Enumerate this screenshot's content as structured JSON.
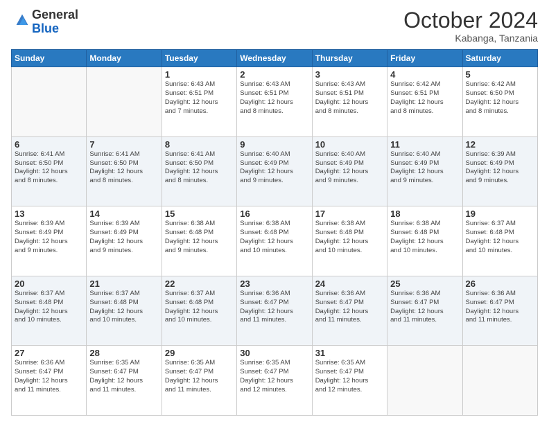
{
  "header": {
    "logo_general": "General",
    "logo_blue": "Blue",
    "month": "October 2024",
    "location": "Kabanga, Tanzania"
  },
  "weekdays": [
    "Sunday",
    "Monday",
    "Tuesday",
    "Wednesday",
    "Thursday",
    "Friday",
    "Saturday"
  ],
  "weeks": [
    [
      {
        "day": "",
        "info": ""
      },
      {
        "day": "",
        "info": ""
      },
      {
        "day": "1",
        "info": "Sunrise: 6:43 AM\nSunset: 6:51 PM\nDaylight: 12 hours\nand 7 minutes."
      },
      {
        "day": "2",
        "info": "Sunrise: 6:43 AM\nSunset: 6:51 PM\nDaylight: 12 hours\nand 8 minutes."
      },
      {
        "day": "3",
        "info": "Sunrise: 6:43 AM\nSunset: 6:51 PM\nDaylight: 12 hours\nand 8 minutes."
      },
      {
        "day": "4",
        "info": "Sunrise: 6:42 AM\nSunset: 6:51 PM\nDaylight: 12 hours\nand 8 minutes."
      },
      {
        "day": "5",
        "info": "Sunrise: 6:42 AM\nSunset: 6:50 PM\nDaylight: 12 hours\nand 8 minutes."
      }
    ],
    [
      {
        "day": "6",
        "info": "Sunrise: 6:41 AM\nSunset: 6:50 PM\nDaylight: 12 hours\nand 8 minutes."
      },
      {
        "day": "7",
        "info": "Sunrise: 6:41 AM\nSunset: 6:50 PM\nDaylight: 12 hours\nand 8 minutes."
      },
      {
        "day": "8",
        "info": "Sunrise: 6:41 AM\nSunset: 6:50 PM\nDaylight: 12 hours\nand 8 minutes."
      },
      {
        "day": "9",
        "info": "Sunrise: 6:40 AM\nSunset: 6:49 PM\nDaylight: 12 hours\nand 9 minutes."
      },
      {
        "day": "10",
        "info": "Sunrise: 6:40 AM\nSunset: 6:49 PM\nDaylight: 12 hours\nand 9 minutes."
      },
      {
        "day": "11",
        "info": "Sunrise: 6:40 AM\nSunset: 6:49 PM\nDaylight: 12 hours\nand 9 minutes."
      },
      {
        "day": "12",
        "info": "Sunrise: 6:39 AM\nSunset: 6:49 PM\nDaylight: 12 hours\nand 9 minutes."
      }
    ],
    [
      {
        "day": "13",
        "info": "Sunrise: 6:39 AM\nSunset: 6:49 PM\nDaylight: 12 hours\nand 9 minutes."
      },
      {
        "day": "14",
        "info": "Sunrise: 6:39 AM\nSunset: 6:49 PM\nDaylight: 12 hours\nand 9 minutes."
      },
      {
        "day": "15",
        "info": "Sunrise: 6:38 AM\nSunset: 6:48 PM\nDaylight: 12 hours\nand 9 minutes."
      },
      {
        "day": "16",
        "info": "Sunrise: 6:38 AM\nSunset: 6:48 PM\nDaylight: 12 hours\nand 10 minutes."
      },
      {
        "day": "17",
        "info": "Sunrise: 6:38 AM\nSunset: 6:48 PM\nDaylight: 12 hours\nand 10 minutes."
      },
      {
        "day": "18",
        "info": "Sunrise: 6:38 AM\nSunset: 6:48 PM\nDaylight: 12 hours\nand 10 minutes."
      },
      {
        "day": "19",
        "info": "Sunrise: 6:37 AM\nSunset: 6:48 PM\nDaylight: 12 hours\nand 10 minutes."
      }
    ],
    [
      {
        "day": "20",
        "info": "Sunrise: 6:37 AM\nSunset: 6:48 PM\nDaylight: 12 hours\nand 10 minutes."
      },
      {
        "day": "21",
        "info": "Sunrise: 6:37 AM\nSunset: 6:48 PM\nDaylight: 12 hours\nand 10 minutes."
      },
      {
        "day": "22",
        "info": "Sunrise: 6:37 AM\nSunset: 6:48 PM\nDaylight: 12 hours\nand 10 minutes."
      },
      {
        "day": "23",
        "info": "Sunrise: 6:36 AM\nSunset: 6:47 PM\nDaylight: 12 hours\nand 11 minutes."
      },
      {
        "day": "24",
        "info": "Sunrise: 6:36 AM\nSunset: 6:47 PM\nDaylight: 12 hours\nand 11 minutes."
      },
      {
        "day": "25",
        "info": "Sunrise: 6:36 AM\nSunset: 6:47 PM\nDaylight: 12 hours\nand 11 minutes."
      },
      {
        "day": "26",
        "info": "Sunrise: 6:36 AM\nSunset: 6:47 PM\nDaylight: 12 hours\nand 11 minutes."
      }
    ],
    [
      {
        "day": "27",
        "info": "Sunrise: 6:36 AM\nSunset: 6:47 PM\nDaylight: 12 hours\nand 11 minutes."
      },
      {
        "day": "28",
        "info": "Sunrise: 6:35 AM\nSunset: 6:47 PM\nDaylight: 12 hours\nand 11 minutes."
      },
      {
        "day": "29",
        "info": "Sunrise: 6:35 AM\nSunset: 6:47 PM\nDaylight: 12 hours\nand 11 minutes."
      },
      {
        "day": "30",
        "info": "Sunrise: 6:35 AM\nSunset: 6:47 PM\nDaylight: 12 hours\nand 12 minutes."
      },
      {
        "day": "31",
        "info": "Sunrise: 6:35 AM\nSunset: 6:47 PM\nDaylight: 12 hours\nand 12 minutes."
      },
      {
        "day": "",
        "info": ""
      },
      {
        "day": "",
        "info": ""
      }
    ]
  ]
}
